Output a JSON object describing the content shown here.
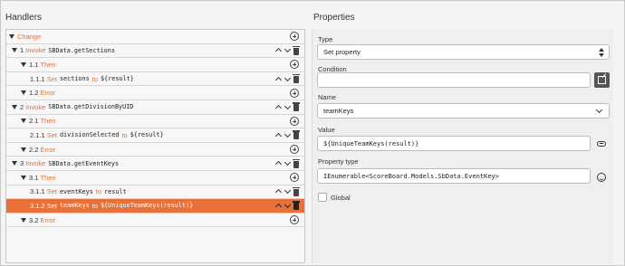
{
  "handlers": {
    "title": "Handlers",
    "rows": [
      {
        "num": "",
        "kw": "Change",
        "code": "",
        "to": "",
        "code2": "",
        "tri": true,
        "arrows": false,
        "trash": false
      },
      {
        "num": "1",
        "kw": "Invoke",
        "code": "SBData.getSections",
        "to": "",
        "code2": "",
        "tri": true,
        "arrows": true,
        "trash": true
      },
      {
        "num": "1.1",
        "kw": "Then",
        "code": "",
        "to": "",
        "code2": "",
        "tri": true,
        "arrows": false,
        "trash": false
      },
      {
        "num": "1.1.1",
        "kw": "Set",
        "code": "sections",
        "to": "to",
        "code2": "${result}",
        "tri": false,
        "arrows": true,
        "trash": true
      },
      {
        "num": "1.2",
        "kw": "Error",
        "code": "",
        "to": "",
        "code2": "",
        "tri": true,
        "arrows": false,
        "trash": false
      },
      {
        "num": "2",
        "kw": "Invoke",
        "code": "SBData.getDivisionByUID",
        "to": "",
        "code2": "",
        "tri": true,
        "arrows": true,
        "trash": true
      },
      {
        "num": "2.1",
        "kw": "Then",
        "code": "",
        "to": "",
        "code2": "",
        "tri": true,
        "arrows": false,
        "trash": false
      },
      {
        "num": "2.1.1",
        "kw": "Set",
        "code": "divisionSelected",
        "to": "to",
        "code2": "${result}",
        "tri": false,
        "arrows": true,
        "trash": true
      },
      {
        "num": "2.2",
        "kw": "Error",
        "code": "",
        "to": "",
        "code2": "",
        "tri": true,
        "arrows": false,
        "trash": false
      },
      {
        "num": "3",
        "kw": "Invoke",
        "code": "SBData.getEventKeys",
        "to": "",
        "code2": "",
        "tri": true,
        "arrows": true,
        "trash": true
      },
      {
        "num": "3.1",
        "kw": "Then",
        "code": "",
        "to": "",
        "code2": "",
        "tri": true,
        "arrows": false,
        "trash": false
      },
      {
        "num": "3.1.1",
        "kw": "Set",
        "code": "eventKeys",
        "to": "to",
        "code2": "result",
        "tri": false,
        "arrows": true,
        "trash": true
      },
      {
        "num": "3.1.2",
        "kw": "Set",
        "code": "teamKeys",
        "to": "to",
        "code2": "${UniqueTeamKeys(result)}",
        "tri": false,
        "arrows": true,
        "trash": true,
        "selected": true
      },
      {
        "num": "3.2",
        "kw": "Error",
        "code": "",
        "to": "",
        "code2": "",
        "tri": true,
        "arrows": false,
        "trash": false
      }
    ]
  },
  "properties": {
    "title": "Properties",
    "type_label": "Type",
    "type_value": "Set property",
    "condition_label": "Condition",
    "condition_value": "",
    "name_label": "Name",
    "name_value": "teamKeys",
    "value_label": "Value",
    "value_value": "${UniqueTeamKeys(result)}",
    "ptype_label": "Property type",
    "ptype_value": "IEnumerable<ScoreBoard.Models.SbData.EventKey>",
    "global_label": "Global"
  },
  "accent_color": "#e8703a"
}
